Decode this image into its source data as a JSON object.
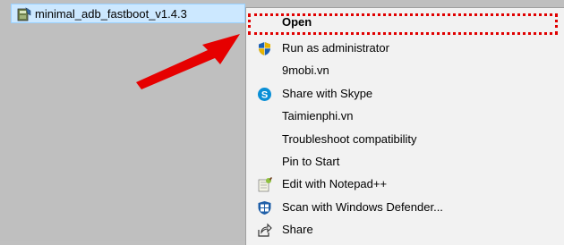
{
  "file": {
    "name": "minimal_adb_fastboot_v1.4.3",
    "icon": "installer-icon"
  },
  "context_menu": {
    "items": [
      {
        "label": "Open",
        "icon": "",
        "default": true
      },
      {
        "label": "Run as administrator",
        "icon": "uac-shield-icon"
      },
      {
        "label": "9mobi.vn",
        "icon": ""
      },
      {
        "label": "Share with Skype",
        "icon": "skype-icon"
      },
      {
        "label": "Taimienphi.vn",
        "icon": ""
      },
      {
        "label": "Troubleshoot compatibility",
        "icon": ""
      },
      {
        "label": "Pin to Start",
        "icon": ""
      },
      {
        "label": "Edit with Notepad++",
        "icon": "notepadpp-icon"
      },
      {
        "label": "Scan with Windows Defender...",
        "icon": "windows-defender-icon"
      },
      {
        "label": "Share",
        "icon": "share-icon"
      }
    ]
  },
  "colors": {
    "highlight": "#e00000",
    "arrow": "#e60000",
    "selection": "#cce8ff"
  }
}
